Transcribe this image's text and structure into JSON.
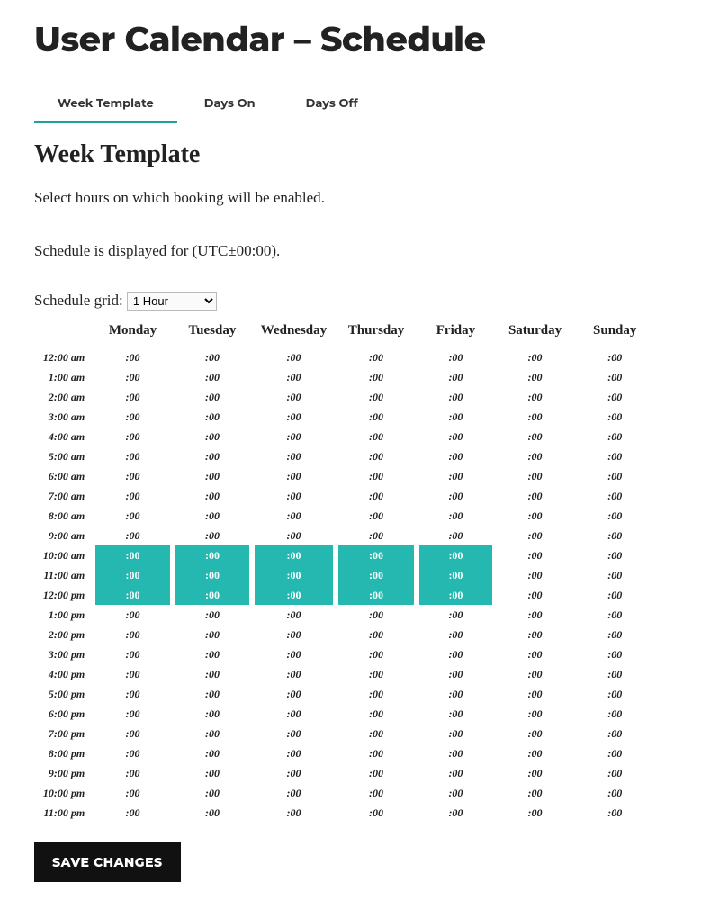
{
  "page": {
    "title": "User Calendar – Schedule"
  },
  "tabs": [
    {
      "label": "Week Template",
      "active": true
    },
    {
      "label": "Days On",
      "active": false
    },
    {
      "label": "Days Off",
      "active": false
    }
  ],
  "section": {
    "title": "Week Template",
    "desc1": "Select hours on which booking will be enabled.",
    "desc2": "Schedule is displayed for (UTC±00:00)."
  },
  "gridSelect": {
    "label": "Schedule grid: ",
    "value": "1 Hour",
    "options": [
      "1 Hour"
    ]
  },
  "schedule": {
    "days": [
      "Monday",
      "Tuesday",
      "Wednesday",
      "Thursday",
      "Friday",
      "Saturday",
      "Sunday"
    ],
    "rows": [
      "12:00 am",
      "1:00 am",
      "2:00 am",
      "3:00 am",
      "4:00 am",
      "5:00 am",
      "6:00 am",
      "7:00 am",
      "8:00 am",
      "9:00 am",
      "10:00 am",
      "11:00 am",
      "12:00 pm",
      "1:00 pm",
      "2:00 pm",
      "3:00 pm",
      "4:00 pm",
      "5:00 pm",
      "6:00 pm",
      "7:00 pm",
      "8:00 pm",
      "9:00 pm",
      "10:00 pm",
      "11:00 pm"
    ],
    "cellText": ":00",
    "selected": [
      {
        "row": 10,
        "col": 0
      },
      {
        "row": 10,
        "col": 1
      },
      {
        "row": 10,
        "col": 2
      },
      {
        "row": 10,
        "col": 3
      },
      {
        "row": 10,
        "col": 4
      },
      {
        "row": 11,
        "col": 0
      },
      {
        "row": 11,
        "col": 1
      },
      {
        "row": 11,
        "col": 2
      },
      {
        "row": 11,
        "col": 3
      },
      {
        "row": 11,
        "col": 4
      },
      {
        "row": 12,
        "col": 0
      },
      {
        "row": 12,
        "col": 1
      },
      {
        "row": 12,
        "col": 2
      },
      {
        "row": 12,
        "col": 3
      },
      {
        "row": 12,
        "col": 4
      }
    ]
  },
  "buttons": {
    "save": "SAVE CHANGES"
  }
}
